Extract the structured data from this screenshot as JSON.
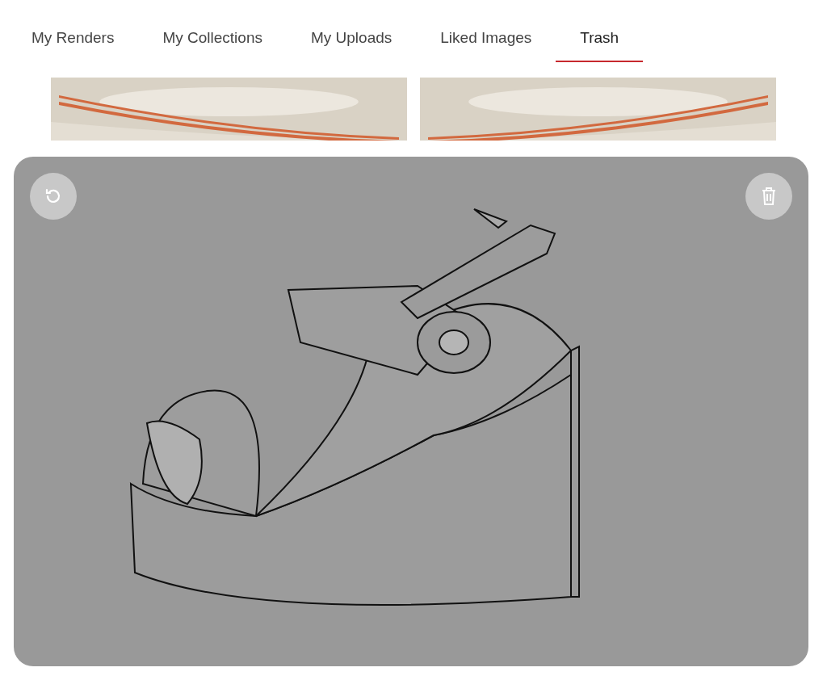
{
  "tabs": [
    {
      "label": "My Renders",
      "selected": false
    },
    {
      "label": "My Collections",
      "selected": false
    },
    {
      "label": "My Uploads",
      "selected": false
    },
    {
      "label": "Liked Images",
      "selected": false
    },
    {
      "label": "Trash",
      "selected": true
    }
  ]
}
